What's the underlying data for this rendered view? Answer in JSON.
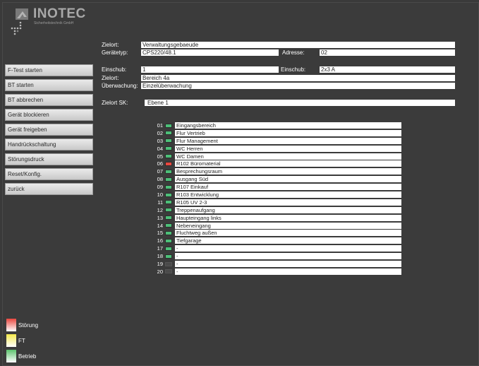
{
  "logo": {
    "brand": "INOTEC",
    "subtitle": "Sicherheitstechnik GmbH"
  },
  "info": {
    "zielort_label": "Zielort:",
    "zielort_value": "Verwaltungsgebaeude",
    "geraetetyp_label": "Gerätetyp:",
    "geraetetyp_value": "CPS220/48.1",
    "adresse_label": "Adresse:",
    "adresse_value": "02",
    "einschub_label": "Einschub:",
    "einschub_value": "1",
    "einschub2_label": "Einschub:",
    "einschub2_value": "2x3 A",
    "zielort2_label": "Zielort:",
    "zielort2_value": "Bereich 4a",
    "ueberwachung_label": "Überwachung:",
    "ueberwachung_value": "Einzelüberwachung",
    "zielort_sk_label": "Zielort SK:",
    "zielort_sk_value": "Ebene 1"
  },
  "sidebar": {
    "items": [
      {
        "label": "F-Test starten"
      },
      {
        "label": "BT starten"
      },
      {
        "label": "BT abbrechen"
      },
      {
        "label": "Gerät blockieren"
      },
      {
        "label": "Gerät freigeben"
      },
      {
        "label": "Handrückschaltung"
      },
      {
        "label": "Störungsdruck"
      },
      {
        "label": "Reset/Konfig."
      },
      {
        "label": "zurück"
      }
    ]
  },
  "circuits": [
    {
      "num": "01",
      "status": "green",
      "name": "Eingangsbereich"
    },
    {
      "num": "02",
      "status": "green",
      "name": "Flur Vertrieb"
    },
    {
      "num": "03",
      "status": "green",
      "name": "Flur Management"
    },
    {
      "num": "04",
      "status": "green",
      "name": "WC Herren"
    },
    {
      "num": "05",
      "status": "green",
      "name": "WC Damen"
    },
    {
      "num": "06",
      "status": "red",
      "name": "R102 Büromaterial"
    },
    {
      "num": "07",
      "status": "green",
      "name": "Besprechungsraum"
    },
    {
      "num": "08",
      "status": "green",
      "name": "Ausgang Süd"
    },
    {
      "num": "09",
      "status": "green",
      "name": "R107 Einkauf"
    },
    {
      "num": "10",
      "status": "green",
      "name": "R103 Entwicklung"
    },
    {
      "num": "11",
      "status": "green",
      "name": "R105 UV 2-3"
    },
    {
      "num": "12",
      "status": "green",
      "name": "Treppenaufgang"
    },
    {
      "num": "13",
      "status": "green",
      "name": "Haupteingang links"
    },
    {
      "num": "14",
      "status": "green",
      "name": "Nebeneingang"
    },
    {
      "num": "15",
      "status": "green",
      "name": "Fluchtweg außen"
    },
    {
      "num": "16",
      "status": "green",
      "name": "Tiefgarage"
    },
    {
      "num": "17",
      "status": "green",
      "name": "-"
    },
    {
      "num": "18",
      "status": "green",
      "name": "-"
    },
    {
      "num": "19",
      "status": "off",
      "name": "-"
    },
    {
      "num": "20",
      "status": "off",
      "name": "-"
    }
  ],
  "legend": {
    "items": [
      {
        "label": "Störung",
        "color": "#e9473f"
      },
      {
        "label": "FT",
        "color": "#f4e94a"
      },
      {
        "label": "Betrieb",
        "color": "#5cc46e"
      }
    ]
  },
  "colors": {
    "background": "#3a3a3a",
    "ok": "#4cbf78",
    "fault": "#e9473f"
  }
}
